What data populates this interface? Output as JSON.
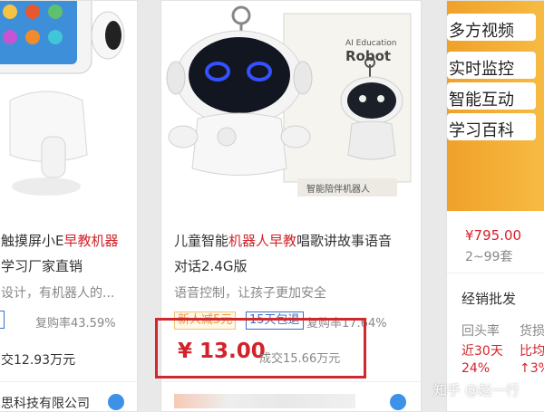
{
  "left_card": {
    "title_black": "触摸屏小E",
    "title_red": "早教机器",
    "line2": "学习厂家直销",
    "line3": "设计，有机器人的...",
    "repurchase": "复购率43.59%",
    "deal": "交12.93万元",
    "shop": "思科技有限公司"
  },
  "mid_card": {
    "box_brand": "AI Education",
    "box_title": "Robot",
    "box_bottom": "智能陪伴机器人",
    "title_a": "儿童智能",
    "title_red": "机器人早教",
    "title_b": "唱歌讲故事语音",
    "title_line2": "对话2.4G版",
    "subtitle": "语音控制，让孩子更加安全",
    "tag_new": "新人减5元",
    "tag_return": "15天包退",
    "repurchase": "复购率17.64%",
    "price": "¥ 13.00",
    "deal": "成交15.66万元"
  },
  "right_card": {
    "banner": [
      "多方视频",
      "实时监控",
      "智能互动",
      "学习百科"
    ],
    "price": "¥795.00",
    "moq": "2~99套",
    "section": "经销批发",
    "col1_label": "回头率",
    "col1_value": "近30天",
    "col1_pct": "24%",
    "col2_label": "货损",
    "col2_value": "比均",
    "col2_pct": "↑3%"
  },
  "watermark": "知乎 @赵一行",
  "colors": {
    "accent_red": "#d4222a",
    "tag_blue": "#3a70c8",
    "highlight_box": "#d0282d"
  }
}
